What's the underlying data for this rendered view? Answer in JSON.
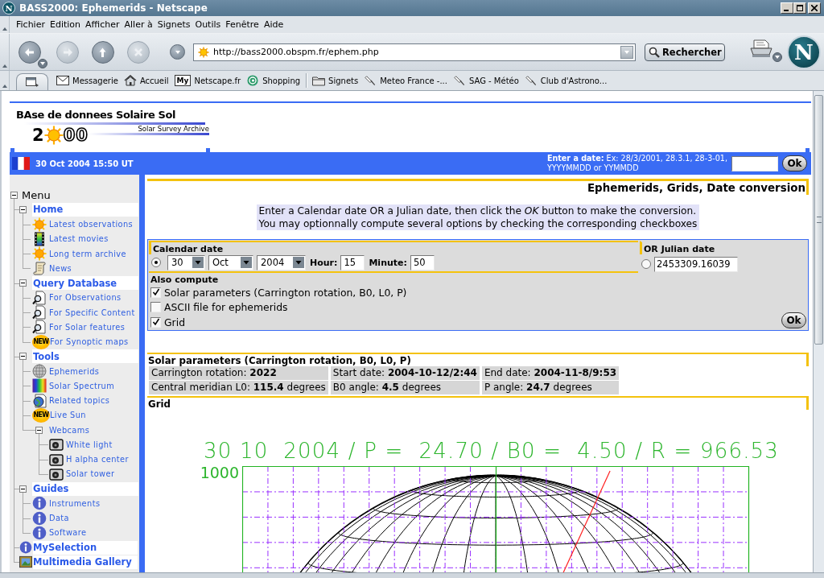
{
  "window": {
    "title": "BASS2000: Ephemerids - Netscape",
    "logo_letter": "N"
  },
  "menu_bar": [
    "Fichier",
    "Edition",
    "Afficher",
    "Aller à",
    "Signets",
    "Outils",
    "Fenêtre",
    "Aide"
  ],
  "navigation": {
    "buttons": [
      {
        "kind": "back",
        "disabled": false
      },
      {
        "kind": "forward",
        "disabled": true
      },
      {
        "kind": "reload",
        "disabled": false
      },
      {
        "kind": "stop",
        "disabled": true
      }
    ],
    "url": "http://bass2000.obspm.fr/ephem.php",
    "search_button": "Rechercher",
    "logo_letter": "N"
  },
  "personal_toolbar": [
    {
      "kind": "mail",
      "label": "Messagerie"
    },
    {
      "kind": "home",
      "label": "Accueil"
    },
    {
      "kind": "my",
      "badge": "My",
      "label": "Netscape.fr"
    },
    {
      "kind": "shopping",
      "label": "Shopping"
    },
    {
      "kind": "folder",
      "label": "Signets"
    },
    {
      "kind": "bookmark",
      "label": "Meteo France -..."
    },
    {
      "kind": "bookmark",
      "label": "SAG - Météo"
    },
    {
      "kind": "bookmark",
      "label": "Club d'Astrono..."
    }
  ],
  "logo": {
    "title": "BAse de donnees Solaire Sol",
    "subtitle": "Solar Survey Archive",
    "year_start": "2",
    "year_end": "00"
  },
  "header_bar": {
    "date": "30 Oct 2004 15:50 UT",
    "hint": [
      "**Enter a date:** Ex: 28/3/2001, 28.3.1, 28-3-01,",
      "YYYYMMDD or YYMMDD"
    ],
    "ok_button": "Ok"
  },
  "sidebar": {
    "title": "Menu",
    "expanded": true,
    "entries": [
      {
        "kind": "section",
        "label": "Home",
        "expanded": true,
        "items": [
          {
            "kind": "sun",
            "label": "Latest observations"
          },
          {
            "kind": "film",
            "label": "Latest movies"
          },
          {
            "kind": "sun",
            "label": "Long term archive"
          },
          {
            "kind": "scroll",
            "label": "News"
          }
        ]
      },
      {
        "kind": "section",
        "label": "Query Database",
        "expanded": true,
        "items": [
          {
            "kind": "magnifier",
            "label": "For Observations"
          },
          {
            "kind": "magnifier",
            "label": "For Specific Content"
          },
          {
            "kind": "magnifier",
            "label": "For Solar features"
          },
          {
            "kind": "new",
            "badge": "NEW",
            "label": "For Synoptic maps"
          }
        ]
      },
      {
        "kind": "section",
        "label": "Tools",
        "expanded": true,
        "items": [
          {
            "kind": "globe",
            "label": "Ephemerids"
          },
          {
            "kind": "spectrum",
            "label": "Solar Spectrum"
          },
          {
            "kind": "globe-doc",
            "label": "Related topics"
          },
          {
            "kind": "new",
            "badge": "NEW",
            "label": "Live Sun"
          },
          {
            "kind": "folder",
            "label": "Webcams",
            "expanded": true,
            "children": [
              {
                "kind": "camera",
                "label": "White light"
              },
              {
                "kind": "camera",
                "label": "H alpha center"
              },
              {
                "kind": "camera",
                "label": "Solar tower"
              }
            ]
          }
        ]
      },
      {
        "kind": "section",
        "label": "Guides",
        "expanded": true,
        "items": [
          {
            "kind": "info",
            "label": "Instruments"
          },
          {
            "kind": "info",
            "label": "Data"
          },
          {
            "kind": "info",
            "label": "Software"
          }
        ]
      },
      {
        "kind": "info",
        "label": "MySelection"
      },
      {
        "kind": "picture",
        "label": "Multimedia Gallery"
      }
    ]
  },
  "page_title": "Ephemerids, Grids, Date conversion",
  "instructions": [
    "Enter a Calendar date OR a Julian date, then click the *OK* button to make the conversion.",
    "You may optionnally compute several options by checking the corresponding checkboxes"
  ],
  "form": {
    "calendar": {
      "heading": "Calendar date",
      "selected": true,
      "day": "30",
      "month": "Oct",
      "year": "2004",
      "hour_label": "Hour:",
      "hour": "15",
      "minute_label": "Minute:",
      "minute": "50"
    },
    "julian": {
      "heading": "OR Julian date",
      "selected": false,
      "value": "2453309.16039"
    },
    "also_compute": {
      "heading": "Also compute",
      "options": [
        {
          "label": "Solar parameters (Carrington rotation, B0, L0, P)",
          "checked": true
        },
        {
          "label": "ASCII file for ephemerids",
          "checked": false
        },
        {
          "label": "Grid",
          "checked": true
        }
      ]
    },
    "ok_button": "Ok"
  },
  "solar_parameters": {
    "heading": "Solar parameters (Carrington rotation, B0, L0, P)",
    "rows": [
      [
        "Carrington rotation: **2022**",
        "Start date: **2004-10-12/2:44**",
        "End date: **2004-11-8/9:53**"
      ],
      [
        "Central meridian L0: **115.4** degrees",
        "B0 angle: **4.5** degrees",
        "P angle: **24.7** degrees"
      ]
    ]
  },
  "grid": {
    "heading": "Grid",
    "plot_title": "30 10  2004 / P =  24.70 / B0 =  4.50 / R = 966.53",
    "y_label": "1000"
  }
}
